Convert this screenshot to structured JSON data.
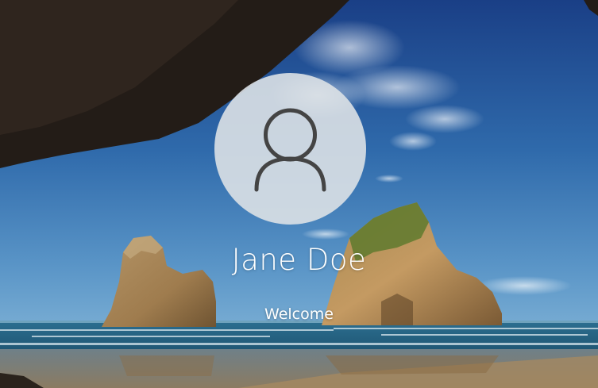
{
  "lock_screen": {
    "user_name": "Jane Doe",
    "status_text": "Welcome",
    "avatar_icon": "user-icon"
  },
  "colors": {
    "avatar_circle": "#dce1e6",
    "avatar_glyph": "#444444",
    "text": "#ffffff",
    "sky_top": "#1d4f95",
    "sky_bottom": "#4f8bbf"
  }
}
